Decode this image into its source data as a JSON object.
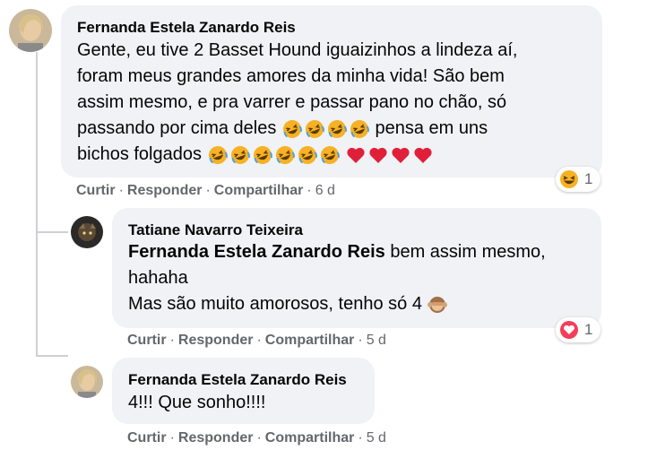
{
  "comments": [
    {
      "author": "Fernanda Estela Zanardo Reis",
      "lines": [
        "Gente, eu tive 2 Basset Hound iguaizinhos a lindeza aí,",
        "foram meus grandes amores da minha vida! São bem",
        "assim mesmo, e pra varrer e passar pano no chão, só",
        "passando por cima deles",
        "pensa em uns",
        "bichos folgados"
      ],
      "actions": {
        "like": "Curtir",
        "reply": "Responder",
        "share": "Compartilhar",
        "time": "6 d"
      },
      "reaction": {
        "icon": "laughing-reaction-icon",
        "count": "1"
      }
    },
    {
      "author": "Tatiane Navarro Teixeira",
      "mention": "Fernanda Estela Zanardo Reis",
      "lines": [
        "bem assim mesmo,",
        "hahaha",
        "Mas são muito amorosos, tenho só 4"
      ],
      "actions": {
        "like": "Curtir",
        "reply": "Responder",
        "share": "Compartilhar",
        "time": "5 d"
      },
      "reaction": {
        "icon": "love-reaction-icon",
        "count": "1"
      }
    },
    {
      "author": "Fernanda Estela Zanardo Reis",
      "lines": [
        "4!!! Que sonho!!!!"
      ],
      "actions": {
        "like": "Curtir",
        "reply": "Responder",
        "share": "Compartilhar",
        "time": "5 d"
      }
    }
  ],
  "separator": "·",
  "colors": {
    "bubble": "#f0f2f5",
    "meta": "#65676b",
    "love": "#f33e58",
    "laugh": "#f7b125"
  }
}
